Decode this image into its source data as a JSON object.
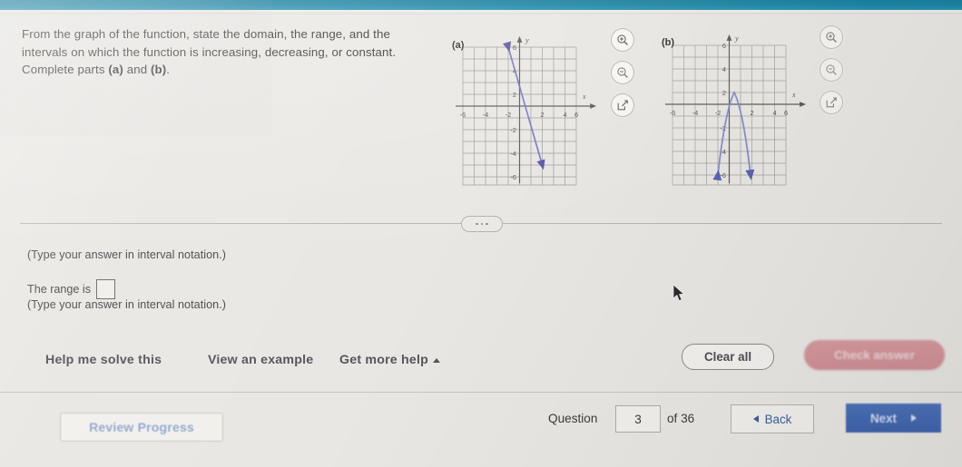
{
  "problem": {
    "line1": "From the graph of the function, state the domain, the range, and the",
    "line2": "intervals on which the function is increasing, decreasing, or constant.",
    "line3_prefix": "Complete parts ",
    "line3_a": "(a)",
    "line3_mid": " and ",
    "line3_b": "(b)",
    "line3_suffix": "."
  },
  "graphs": [
    {
      "label": "(a)",
      "x_ticks": [
        "-6",
        "-4",
        "-2",
        "2",
        "4",
        "6"
      ],
      "y_ticks": [
        "6",
        "4",
        "2",
        "-2",
        "-4",
        "-6"
      ],
      "x_axis_label": "x",
      "y_axis_label": "y",
      "curve_color": "#6f6bc4"
    },
    {
      "label": "(b)",
      "x_ticks": [
        "-6",
        "-4",
        "-2",
        "2",
        "4",
        "6"
      ],
      "y_ticks": [
        "6",
        "4",
        "2",
        "-2",
        "-4",
        "-6"
      ],
      "x_axis_label": "x",
      "y_axis_label": "y",
      "curve_color": "#7d86cb"
    }
  ],
  "graph_tools": [
    {
      "name": "zoom-in-icon",
      "label": "Zoom in"
    },
    {
      "name": "zoom-out-icon",
      "label": "Zoom out"
    },
    {
      "name": "open-editor-icon",
      "label": "Open graph editor"
    }
  ],
  "answer": {
    "hint_top": "(Type your answer in interval notation.)",
    "range_label": "The range is",
    "range_value": "",
    "hint_bottom": "(Type your answer in interval notation.)"
  },
  "help": {
    "solve": "Help me solve this",
    "example": "View an example",
    "more": "Get more help",
    "clear_all": "Clear all",
    "check_answer": "Check answer"
  },
  "footer": {
    "review_progress": "Review Progress",
    "question_label": "Question",
    "question_number": "3",
    "of_label": "of 36",
    "back": "Back",
    "next": "Next"
  },
  "chart_data": [
    {
      "type": "line",
      "title": "(a)",
      "xlabel": "x",
      "ylabel": "y",
      "xlim": [
        -7,
        7
      ],
      "ylim": [
        -7,
        7
      ],
      "grid": true,
      "x": [
        -2,
        2
      ],
      "y": [
        6,
        -6
      ],
      "arrow_start": true,
      "arrow_end": true,
      "note": "Decreasing line segment with arrowheads at both ends, from (-2, 6) to (2, -6); slope -3."
    },
    {
      "type": "line",
      "title": "(b)",
      "xlabel": "x",
      "ylabel": "y",
      "xlim": [
        -7,
        7
      ],
      "ylim": [
        -7,
        7
      ],
      "grid": true,
      "x": [
        -2,
        -1.5,
        -1,
        -0.5,
        0,
        0.5,
        1,
        1.5,
        2
      ],
      "y": [
        -6,
        -3.75,
        -2,
        -0.25,
        0.75,
        1,
        0.75,
        -0.25,
        -6
      ],
      "arrow_start": true,
      "arrow_end": true,
      "note": "Downward-opening parabola, vertex near (0.5, 1), arms extending down to about y = -6 at x = -2 and x = 2."
    }
  ],
  "colors": {
    "page_background": "#e9e7e3",
    "top_bar": "#1d86a6",
    "next_button": "#3f63ad",
    "check_answer_button": "#cf8f96",
    "link_blue": "#3e5da0",
    "review_progress_text": "#93a8cf"
  }
}
